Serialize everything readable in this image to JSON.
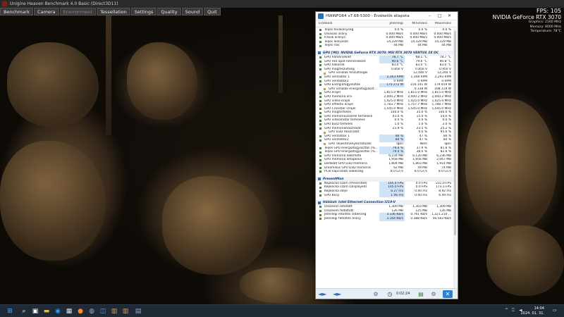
{
  "window": {
    "title": "Unigine Heaven Benchmark 4.0 Basic (Direct3D11)"
  },
  "menu": [
    "Benchmark",
    "Camera",
    "Environment",
    "Tessellation",
    "Settings",
    "Quality",
    "Sound",
    "Quit"
  ],
  "overlay": {
    "fps": "FPS: 105",
    "gpu_name": "NVIDIA GeForce RTX 3070",
    "lines": [
      "Graphics: 2160 MHz",
      "Memory: 8000 MHz",
      "Temperature: 78°C"
    ]
  },
  "hwinfo": {
    "title": "HWiNFO64 v7.68-5300 - Érzékelők állapota",
    "columns": [
      "Érzékelő",
      "Jelenlegi",
      "Minimális",
      "Maximális"
    ],
    "timer": "0:02:24",
    "rows": [
      {
        "t": "s",
        "n": "Teljes tevékenység",
        "v": [
          "0.0 %",
          "0.0 %",
          "0.0 %"
        ]
      },
      {
        "t": "s",
        "n": "Olvasási arány",
        "v": [
          "0.000 MB/s",
          "0.000 MB/s",
          "0.000 MB/s"
        ]
      },
      {
        "t": "s",
        "n": "Írások aránya",
        "v": [
          "0.000 MB/s",
          "0.000 MB/s",
          "0.000 MB/s"
        ]
      },
      {
        "t": "s",
        "n": "Teljes leolvasás",
        "v": [
          "14,329 MB",
          "14,329 MB",
          "14,329 MB"
        ]
      },
      {
        "t": "s",
        "n": "Teljes írás",
        "v": [
          "44 MB",
          "44 MB",
          "44 MB"
        ]
      },
      {
        "t": "gap"
      },
      {
        "t": "g",
        "n": "GPU [#0]: NVIDIA GeForce RTX 3070: MSI RTX 3070 VENTUS 2X OC"
      },
      {
        "t": "s",
        "n": "GPU hőmérséklet",
        "v": [
          "78.7 °C",
          "68.1 °C",
          "78.7 °C"
        ],
        "sel": true
      },
      {
        "t": "s",
        "n": "GPU Hot Spot hőmérséklet",
        "v": [
          "90.6 °C",
          "79.6 °C",
          "90.8 °C"
        ],
        "sel": true
      },
      {
        "t": "s",
        "n": "GPU hőkorlát",
        "v": [
          "83.0 °C",
          "83.0 °C",
          "83.0 °C"
        ]
      },
      {
        "t": "s",
        "n": "GPU magfeszültség",
        "v": [
          "0.850 V",
          "0.850 V",
          "0.950 V"
        ]
      },
      {
        "t": "sub",
        "n": "GPU vonalak feszültségei",
        "v": [
          "",
          "12,040 V",
          "12,244 V"
        ]
      },
      {
        "t": "s",
        "n": "GPU ventilátor 1",
        "v": [
          "2,263 RPM",
          "1,348 RPM",
          "2,293 RPM"
        ],
        "sel": true
      },
      {
        "t": "s",
        "n": "GPU ventilátor2",
        "v": [
          "0 RPM",
          "0 RPM",
          "0 RPM"
        ]
      },
      {
        "t": "s",
        "n": "GPU Energiafogyasztás",
        "v": [
          "175.272 W",
          "154.141 W",
          "179.919 W"
        ],
        "sel": true
      },
      {
        "t": "sub",
        "n": "GPU vonalak energiafogyaszt...",
        "v": [
          "",
          "0.338 W",
          "108.119 W"
        ]
      },
      {
        "t": "s",
        "n": "GPU órajel",
        "v": [
          "1,815.0 MHz",
          "1,815.0 MHz",
          "1,815.0 MHz"
        ]
      },
      {
        "t": "s",
        "n": "GPU memória óra",
        "v": [
          "2,000.2 MHz",
          "2,000.2 MHz",
          "2,000.2 MHz"
        ]
      },
      {
        "t": "s",
        "n": "GPU videó órajel",
        "v": [
          "1,425.0 MHz",
          "1,425.0 MHz",
          "1,425.0 MHz"
        ]
      },
      {
        "t": "s",
        "n": "GPU effektív órajel",
        "v": [
          "1,783.7 MHz",
          "1,757.7 MHz",
          "1,788.7 MHz"
        ]
      },
      {
        "t": "s",
        "n": "GPU Crossbar Órajel",
        "v": [
          "1,545.0 MHz",
          "1,545.0 MHz",
          "1,545.0 MHz"
        ]
      },
      {
        "t": "s",
        "n": "GPU magterhelés",
        "v": [
          "100.0 %",
          "35.0 %",
          "100.0 %"
        ]
      },
      {
        "t": "s",
        "n": "GPU memóriavezérlő terhelése",
        "v": [
          "43.0 %",
          "15.0 %",
          "54.0 %"
        ]
      },
      {
        "t": "s",
        "n": "GPU videomotor terhelése",
        "v": [
          "0.0 %",
          "0.0 %",
          "0.0 %"
        ]
      },
      {
        "t": "s",
        "n": "GPU busz terhelés",
        "v": [
          "1.0 %",
          "1.0 %",
          "3.0 %"
        ]
      },
      {
        "t": "s",
        "n": "GPU memóriahasználat",
        "v": [
          "23.9 %",
          "23.5 %",
          "25.2 %"
        ]
      },
      {
        "t": "sub",
        "n": "GPU D3D Használat",
        "v": [
          "",
          "0.0 %",
          "95.6 %"
        ]
      },
      {
        "t": "s",
        "n": "GPU ventilátor 1",
        "v": [
          "84 %",
          "47 %",
          "84 %"
        ],
        "sel": true
      },
      {
        "t": "s",
        "n": "GPU ventilátor2",
        "v": [
          "84 %",
          "47 %",
          "84 %"
        ],
        "sel": true
      },
      {
        "t": "sub",
        "n": "GPU Teljesítménykorlátozók",
        "v": [
          "Igen",
          "Nem",
          "Igen"
        ]
      },
      {
        "t": "s",
        "n": "Teljes GPU energiafogyasztás (%...",
        "v": [
          "79.4 %",
          "37.9 %",
          "81.8 %"
        ],
        "sel": true
      },
      {
        "t": "s",
        "n": "Teljes GPU energiafogyasztás (%...",
        "v": [
          "79.4 %",
          "38.0 %",
          "82.6 %"
        ],
        "sel": true
      },
      {
        "t": "s",
        "n": "GPU memória elkérhető",
        "v": [
          "6,234 MB",
          "6,120 MB",
          "6,236 MB"
        ]
      },
      {
        "t": "s",
        "n": "GPU memória lefoglalva",
        "v": [
          "1,958 MB",
          "1,956 MB",
          "2,067 MB"
        ]
      },
      {
        "t": "s",
        "n": "Dedikált GPU D3D memória",
        "v": [
          "1,804 MB",
          "1,803 MB",
          "1,914 MB"
        ]
      },
      {
        "t": "s",
        "n": "Dinamikus GPU D3D memória",
        "v": [
          "62 MB",
          "59 MB",
          "74 MB"
        ]
      },
      {
        "t": "s",
        "n": "PCIe kapcsolati sebesség",
        "v": [
          "8.0 GT/s",
          "8.0 GT/s",
          "8.0 GT/s"
        ]
      },
      {
        "t": "gap"
      },
      {
        "t": "g",
        "n": "PresentMon"
      },
      {
        "t": "s",
        "n": "Képkocka szám (Presented)",
        "v": [
          "105.4 FPS",
          "0.0 FPS",
          "231.0 FPS"
        ],
        "sel": true
      },
      {
        "t": "s",
        "n": "Képkocka szám (Displayed)",
        "v": [
          "105.0 FPS",
          "0.0 FPS",
          "173.1 FPS"
        ],
        "sel": true
      },
      {
        "t": "s",
        "n": "Képkocka ideje",
        "v": [
          "6.27 ms",
          "0.00 ms",
          "8.92 ms"
        ],
        "sel": true
      },
      {
        "t": "s",
        "n": "GPU Busy",
        "v": [
          "1.06 ms",
          "0.00 ms",
          "6.49 ms"
        ],
        "sel": true
      },
      {
        "t": "gap"
      },
      {
        "t": "g",
        "n": "Hálózat: Intel Ethernet Connection I219-V"
      },
      {
        "t": "s",
        "n": "Összesen letöltött",
        "v": [
          "1,309 MB",
          "1,303 MB",
          "1,309 MB"
        ]
      },
      {
        "t": "s",
        "n": "Összesen feltöltött",
        "v": [
          "126 MB",
          "125 MB",
          "126 MB"
        ]
      },
      {
        "t": "s",
        "n": "Jelenlegi letöltési sebesség",
        "v": [
          "3.336 KB/s",
          "0.761 KB/s",
          "1,221.210 ..."
        ],
        "sel": true
      },
      {
        "t": "s",
        "n": "Jelenlegi feltöltés arány",
        "v": [
          "3.164 KB/s",
          "0.388 KB/s",
          "56.583 KB/s"
        ],
        "sel": true
      }
    ]
  },
  "taskbar": {
    "clock_time": "14:04",
    "clock_date": "2024. 01. 31."
  }
}
